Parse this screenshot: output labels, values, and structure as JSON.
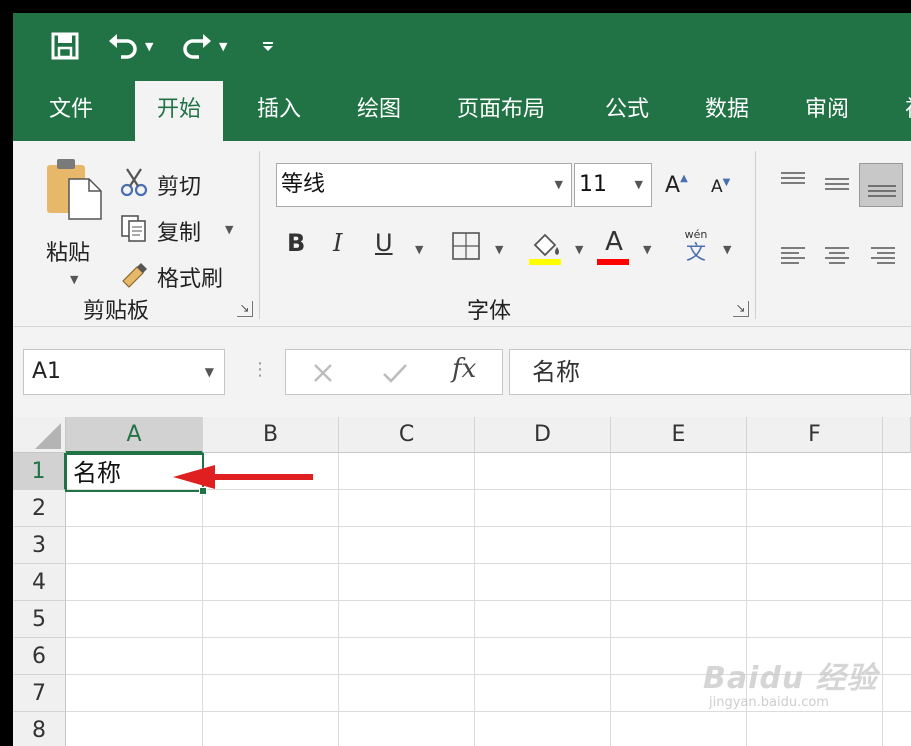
{
  "quick_access": {
    "save": "save-icon",
    "undo": "undo-icon",
    "redo": "redo-icon",
    "customize": "customize-icon"
  },
  "tabs": [
    {
      "label": "文件"
    },
    {
      "label": "开始"
    },
    {
      "label": "插入"
    },
    {
      "label": "绘图"
    },
    {
      "label": "页面布局"
    },
    {
      "label": "公式"
    },
    {
      "label": "数据"
    },
    {
      "label": "审阅"
    },
    {
      "label": "视"
    }
  ],
  "clipboard": {
    "paste_label": "粘贴",
    "cut_label": "剪切",
    "copy_label": "复制",
    "format_painter_label": "格式刷",
    "group_label": "剪贴板"
  },
  "font": {
    "font_name": "等线",
    "font_size": "11",
    "increase_label": "A",
    "decrease_label": "A",
    "bold_label": "B",
    "italic_label": "I",
    "underline_label": "U",
    "font_color_label": "A",
    "phonetic_label": "wén",
    "phonetic_char": "文",
    "group_label": "字体",
    "highlight_color": "#ffff00",
    "font_color": "#ff0000"
  },
  "formula_bar": {
    "name_box": "A1",
    "fx_label": "fx",
    "content": "名称"
  },
  "grid": {
    "columns": [
      "A",
      "B",
      "C",
      "D",
      "E",
      "F"
    ],
    "rows": [
      "1",
      "2",
      "3",
      "4",
      "5",
      "6",
      "7",
      "8"
    ],
    "cell_a1": "名称"
  },
  "watermark": {
    "main": "Baidu 经验",
    "sub": "jingyan.baidu.com"
  },
  "colors": {
    "accent": "#217346",
    "arrow": "#e02020"
  }
}
